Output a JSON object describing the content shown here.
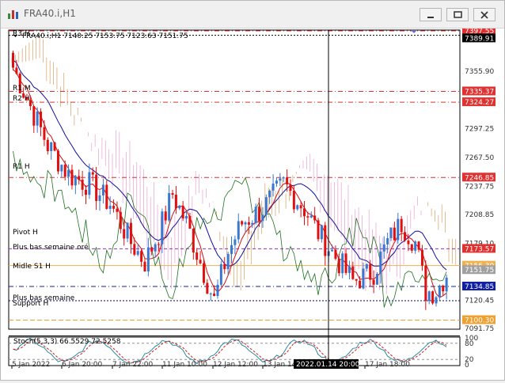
{
  "window": {
    "title": "FRA40.i,H1"
  },
  "chart_info": "FRA40.i,H1  7140.25 7153.75 7123.63 7151.75",
  "stoch_info": "Stoch(5,3,3) 66.5529 72.5258",
  "crosshair_time": "2022.01.14 20:00",
  "time_labels": [
    "5 Jan 2022",
    "6 Jan 20:00",
    "7 Jan 22:00",
    "11 Jan 10:00",
    "12 Jan 12:00",
    "13 Jan 14:00",
    "17 Jan 18:00"
  ],
  "price_labels": [
    "7355.90",
    "7297.25",
    "7267.50",
    "7237.75",
    "7208.85",
    "7179.10",
    "7120.45",
    "7091.75"
  ],
  "price_tags": [
    {
      "text": "7397.55",
      "color": "#e03030"
    },
    {
      "text": "7389.91",
      "color": "#000000"
    },
    {
      "text": "7335.37",
      "color": "#e03030"
    },
    {
      "text": "7324.27",
      "color": "#e03030"
    },
    {
      "text": "7246.85",
      "color": "#e03030"
    },
    {
      "text": "7173.57",
      "color": "#e03030"
    },
    {
      "text": "7156.30",
      "color": "#f0b050"
    },
    {
      "text": "7151.75",
      "color": "#a0a0a0"
    },
    {
      "text": "7134.85",
      "color": "#1020a0"
    },
    {
      "text": "7100.30",
      "color": "#f0a030"
    }
  ],
  "level_labels": [
    "R3 H",
    "R1 M",
    "R2 H",
    "R1 H",
    "Pivot H",
    "Plus bas semaine oré",
    "Midle S1 H",
    "Plus bas semaine",
    "Support H"
  ],
  "stoch_levels": [
    "100",
    "80",
    "20",
    "0"
  ],
  "chart_data": {
    "type": "candlestick",
    "symbol": "FRA40.i",
    "timeframe": "H1",
    "ohlc": [
      7140.25,
      7153.75,
      7123.63,
      7151.75
    ],
    "price_axis": [
      7091.75,
      7397.55
    ],
    "levels": [
      {
        "label": "R3 H",
        "value": 7397.55
      },
      {
        "label": "R1 M",
        "value": 7335.37
      },
      {
        "label": "R2 H",
        "value": 7324.27
      },
      {
        "label": "R1 H",
        "value": 7246.85
      },
      {
        "label": "Pivot H",
        "value": 7173.57
      },
      {
        "label": "Plus bas semaine oré",
        "value": 7156.3
      },
      {
        "label": "Midle S1 H",
        "value": 7134.85
      },
      {
        "label": "Plus bas semaine",
        "value": 7100.3
      }
    ],
    "stochastic": {
      "k": 66.5529,
      "d": 72.5258,
      "levels": [
        80,
        20
      ]
    }
  }
}
